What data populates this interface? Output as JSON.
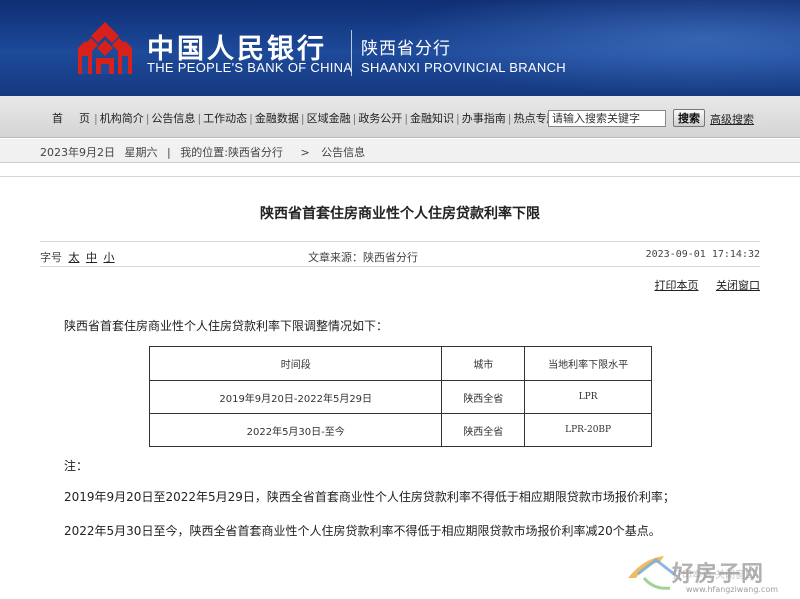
{
  "header": {
    "bank_name_cn": "中国人民银行",
    "bank_name_en": "THE PEOPLE'S BANK OF CHINA",
    "branch_cn": "陕西省分行",
    "branch_en": "SHAANXI PROVINCIAL BRANCH",
    "logo_icon": "pboc-logo-icon",
    "colors": {
      "banner": "#1d4a9a",
      "logo": "#d9211c"
    }
  },
  "nav": {
    "items": [
      {
        "label": "首页"
      },
      {
        "label": "机构简介"
      },
      {
        "label": "公告信息"
      },
      {
        "label": "工作动态"
      },
      {
        "label": "金融数据"
      },
      {
        "label": "区域金融"
      },
      {
        "label": "政务公开"
      },
      {
        "label": "金融知识"
      },
      {
        "label": "办事指南"
      },
      {
        "label": "热点专题"
      }
    ],
    "separator": "|",
    "search_placeholder": "请输入搜索关键字",
    "search_button": "搜索",
    "advanced_search": "高级搜索"
  },
  "breadcrumb": {
    "date": "2023年9月2日",
    "weekday": "星期六",
    "divider": "|",
    "location_label": "我的位置:",
    "branch": "陕西省分行",
    "chevron": ">",
    "current": "公告信息"
  },
  "article": {
    "title": "陕西省首套住房商业性个人住房贷款利率下限",
    "font_size_label": "字号",
    "font_sizes": [
      "太",
      "中",
      "小"
    ],
    "source_label": "文章来源：",
    "source": "陕西省分行",
    "published": "2023-09-01  17:14:32",
    "print_label": "打印本页",
    "close_label": "关闭窗口",
    "intro": "陕西省首套住房商业性个人住房贷款利率下限调整情况如下：",
    "table": {
      "headers": [
        "时间段",
        "城市",
        "当地利率下限水平"
      ],
      "rows": [
        [
          "2019年9月20日-2022年5月29日",
          "陕西全省",
          "LPR"
        ],
        [
          "2022年5月30日-至今",
          "陕西全省",
          "LPR-20BP"
        ]
      ]
    },
    "note_label": "注：",
    "notes": [
      "2019年9月20日至2022年5月29日，陕西全省首套商业性个人住房贷款利率不得低于相应期限贷款市场报价利率；",
      "2022年5月30日至今，陕西全省首套商业性个人住房贷款利率不得低于相应期限贷款市场报价利率减20个基点。"
    ]
  },
  "footer": {
    "ghost_links": "打印本页   关闭窗口"
  },
  "watermark": {
    "icon": "house-roof-icon",
    "text": "好房子网",
    "url": "www.hfangziwang.com"
  }
}
